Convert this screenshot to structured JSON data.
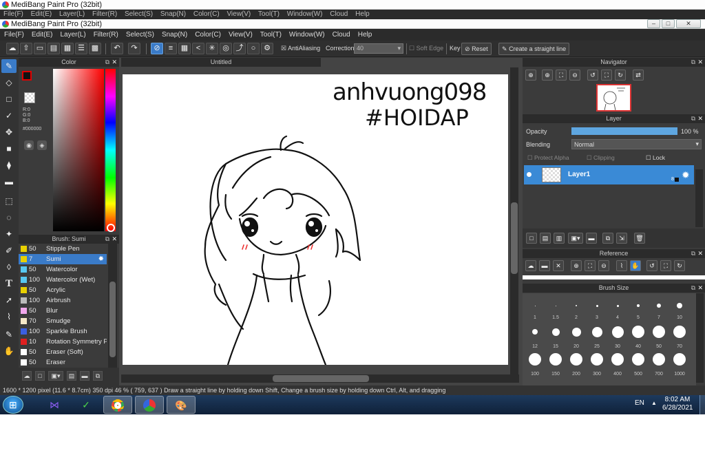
{
  "background_window": {
    "title": "MediBang Paint Pro (32bit)",
    "menu": [
      "File(F)",
      "Edit(E)",
      "Layer(L)",
      "Filter(R)",
      "Select(S)",
      "Snap(N)",
      "Color(C)",
      "View(V)",
      "Tool(T)",
      "Window(W)",
      "Cloud",
      "Help"
    ]
  },
  "window": {
    "title": "MediBang Paint Pro (32bit)",
    "controls": {
      "minimize": "–",
      "maximize": "□",
      "close": "✕"
    }
  },
  "menu": [
    "File(F)",
    "Edit(E)",
    "Layer(L)",
    "Filter(R)",
    "Select(S)",
    "Snap(N)",
    "Color(C)",
    "View(V)",
    "Tool(T)",
    "Window(W)",
    "Cloud",
    "Help"
  ],
  "toolbar": {
    "antialiasing": "AntiAliasing",
    "correction_label": "Correction",
    "correction_value": "40",
    "soft_edge": "Soft Edge",
    "key_label": "Key",
    "reset": "Reset",
    "straight_line": "Create a straight line"
  },
  "color_panel": {
    "title": "Color",
    "r": "R:0",
    "g": "G:0",
    "b": "B:0",
    "hex": "#000000",
    "primary_color": "#e00000",
    "secondary_color": "#111111"
  },
  "brush_panel": {
    "title": "Brush: Sumi",
    "items": [
      {
        "size": "50",
        "name": "Stipple Pen",
        "color": "#e8d000"
      },
      {
        "size": "7",
        "name": "Sumi",
        "color": "#e8d000",
        "selected": true
      },
      {
        "size": "50",
        "name": "Watercolor",
        "color": "#58c8f0"
      },
      {
        "size": "100",
        "name": "Watercolor (Wet)",
        "color": "#58c8f0"
      },
      {
        "size": "50",
        "name": "Acrylic",
        "color": "#e8d000"
      },
      {
        "size": "100",
        "name": "Airbrush",
        "color": "#bbbbbb"
      },
      {
        "size": "50",
        "name": "Blur",
        "color": "#f2a8ec"
      },
      {
        "size": "70",
        "name": "Smudge",
        "color": "#f5e8c8"
      },
      {
        "size": "100",
        "name": "Sparkle Brush",
        "color": "#3b5fe0"
      },
      {
        "size": "10",
        "name": "Rotation Symmetry P",
        "color": "#e02020"
      },
      {
        "size": "50",
        "name": "Eraser (Soft)",
        "color": "#ffffff"
      },
      {
        "size": "50",
        "name": "Eraser",
        "color": "#ffffff"
      }
    ]
  },
  "canvas": {
    "tab_title": "Untitled",
    "signature_text": "anhvuong098",
    "tag_text": "#HOIDAP"
  },
  "navigator": {
    "title": "Navigator"
  },
  "layer_panel": {
    "title": "Layer",
    "opacity_label": "Opacity",
    "opacity_value": "100 %",
    "opacity_fraction": 1.0,
    "blending_label": "Blending",
    "blending_value": "Normal",
    "protect_alpha": "Protect Alpha",
    "clipping": "Clipping",
    "lock": "Lock",
    "layer_name": "Layer1",
    "layer_badge": "8"
  },
  "reference_panel": {
    "title": "Reference"
  },
  "brush_size_panel": {
    "title": "Brush Size",
    "sizes": [
      "1",
      "1.5",
      "2",
      "3",
      "4",
      "5",
      "7",
      "10",
      "12",
      "15",
      "20",
      "25",
      "30",
      "40",
      "50",
      "70",
      "100",
      "150",
      "200",
      "300",
      "400",
      "500",
      "700",
      "1000"
    ]
  },
  "status_bar": {
    "dimensions": "1600 * 1200 pixel",
    "physical": "(11.6 * 8.7cm)",
    "dpi": "350 dpi",
    "zoom": "46 %",
    "coords": "( 759, 637 )",
    "hint": "Draw a straight line by holding down Shift, Change a brush size by holding down Ctrl, Alt, and dragging"
  },
  "taskbar": {
    "language": "EN",
    "time": "8:02 AM",
    "date": "6/28/2021"
  }
}
